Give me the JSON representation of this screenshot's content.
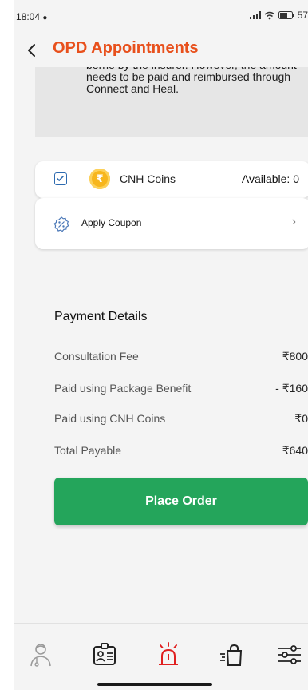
{
  "status_bar": {
    "time": "18:04",
    "battery": "57"
  },
  "header": {
    "title": "OPD Appointments"
  },
  "notice": {
    "text": "borne by the insurer. However, the amount needs to be paid and reimbursed through Connect and Heal."
  },
  "coins": {
    "label": "CNH Coins",
    "available": "Available: 0",
    "checked": true,
    "coin_symbol": "₹"
  },
  "coupon": {
    "label": "Apply Coupon",
    "arrow": "›"
  },
  "payment": {
    "title": "Payment Details",
    "rows": [
      {
        "label": "Consultation Fee",
        "amount": "₹800"
      },
      {
        "label": "Paid using Package Benefit",
        "amount": "- ₹160"
      },
      {
        "label": "Paid using CNH Coins",
        "amount": "₹0"
      },
      {
        "label": "Total Payable",
        "amount": "₹640"
      }
    ]
  },
  "actions": {
    "place_order": "Place Order"
  },
  "bottom_nav": {
    "items": [
      "doctor-icon",
      "id-card-icon",
      "emergency-alarm-icon",
      "shopping-bag-icon",
      "settings-sliders-icon"
    ],
    "active_color": "#e02020"
  },
  "colors": {
    "brand": "#e8501c",
    "primary_button": "#24a55b"
  }
}
